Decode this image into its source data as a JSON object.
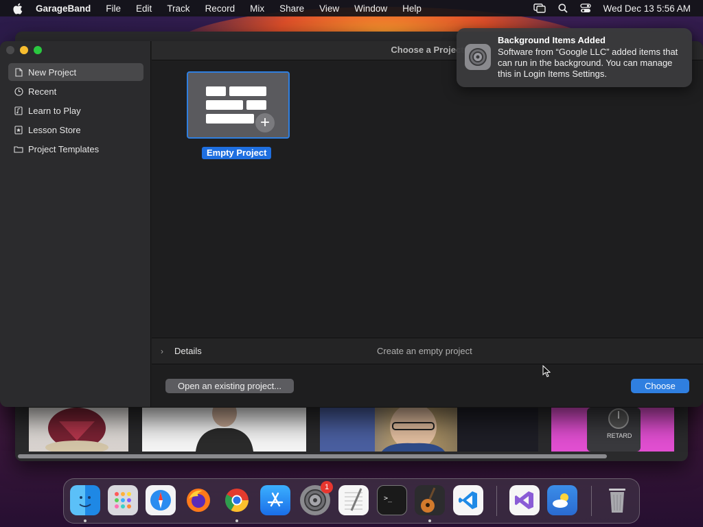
{
  "menubar": {
    "app_name": "GarageBand",
    "items": [
      "File",
      "Edit",
      "Track",
      "Record",
      "Mix",
      "Share",
      "View",
      "Window",
      "Help"
    ],
    "datetime": "Wed Dec 13  5:56 AM"
  },
  "window": {
    "title": "Choose a Project",
    "sidebar": {
      "items": [
        {
          "label": "New Project",
          "icon": "document-icon",
          "selected": true
        },
        {
          "label": "Recent",
          "icon": "clock-icon",
          "selected": false
        },
        {
          "label": "Learn to Play",
          "icon": "music-note-icon",
          "selected": false
        },
        {
          "label": "Lesson Store",
          "icon": "star-icon",
          "selected": false
        },
        {
          "label": "Project Templates",
          "icon": "folder-icon",
          "selected": false
        }
      ]
    },
    "project_tile": {
      "label": "Empty Project"
    },
    "details": {
      "label": "Details",
      "description": "Create an empty project"
    },
    "buttons": {
      "open_existing": "Open an existing project...",
      "choose": "Choose"
    }
  },
  "notification": {
    "title": "Background Items Added",
    "body": "Software from “Google LLC” added items that can run in the background. You can manage this in Login Items Settings."
  },
  "background_window": {
    "thumbnail_text": "RETARD"
  },
  "dock": {
    "apps": [
      {
        "name": "finder-icon",
        "running": true
      },
      {
        "name": "launchpad-icon",
        "running": false
      },
      {
        "name": "safari-icon",
        "running": false
      },
      {
        "name": "firefox-icon",
        "running": false
      },
      {
        "name": "chrome-icon",
        "running": true
      },
      {
        "name": "app-store-icon",
        "running": false
      },
      {
        "name": "system-settings-icon",
        "running": false,
        "badge": "1"
      },
      {
        "name": "textedit-icon",
        "running": false
      },
      {
        "name": "terminal-icon",
        "running": false
      },
      {
        "name": "garageband-icon",
        "running": true
      },
      {
        "name": "vscode-icon",
        "running": false
      },
      {
        "name": "visual-studio-icon",
        "running": false
      },
      {
        "name": "weather-icon",
        "running": false
      },
      {
        "name": "trash-icon",
        "running": false
      }
    ]
  },
  "colors": {
    "accent": "#2f7fe0",
    "window_bg": "#1e1e1f",
    "sidebar_bg": "#2b2b2d",
    "badge": "#e8362f"
  }
}
